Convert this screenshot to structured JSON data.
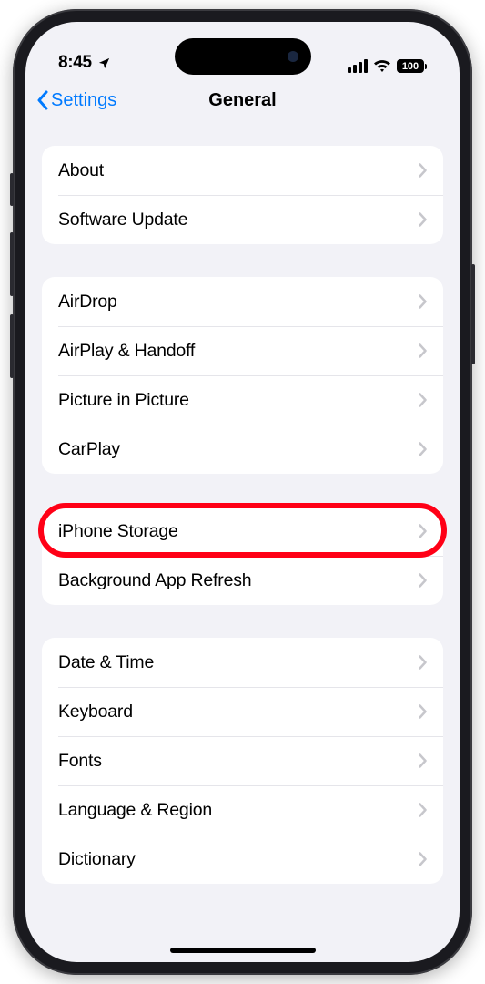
{
  "status": {
    "time": "8:45",
    "battery": "100"
  },
  "nav": {
    "back": "Settings",
    "title": "General"
  },
  "groups": [
    {
      "rows": [
        {
          "label": "About"
        },
        {
          "label": "Software Update"
        }
      ]
    },
    {
      "rows": [
        {
          "label": "AirDrop"
        },
        {
          "label": "AirPlay & Handoff"
        },
        {
          "label": "Picture in Picture"
        },
        {
          "label": "CarPlay"
        }
      ]
    },
    {
      "rows": [
        {
          "label": "iPhone Storage",
          "highlight": true
        },
        {
          "label": "Background App Refresh"
        }
      ]
    },
    {
      "rows": [
        {
          "label": "Date & Time"
        },
        {
          "label": "Keyboard"
        },
        {
          "label": "Fonts"
        },
        {
          "label": "Language & Region"
        },
        {
          "label": "Dictionary"
        }
      ]
    }
  ]
}
